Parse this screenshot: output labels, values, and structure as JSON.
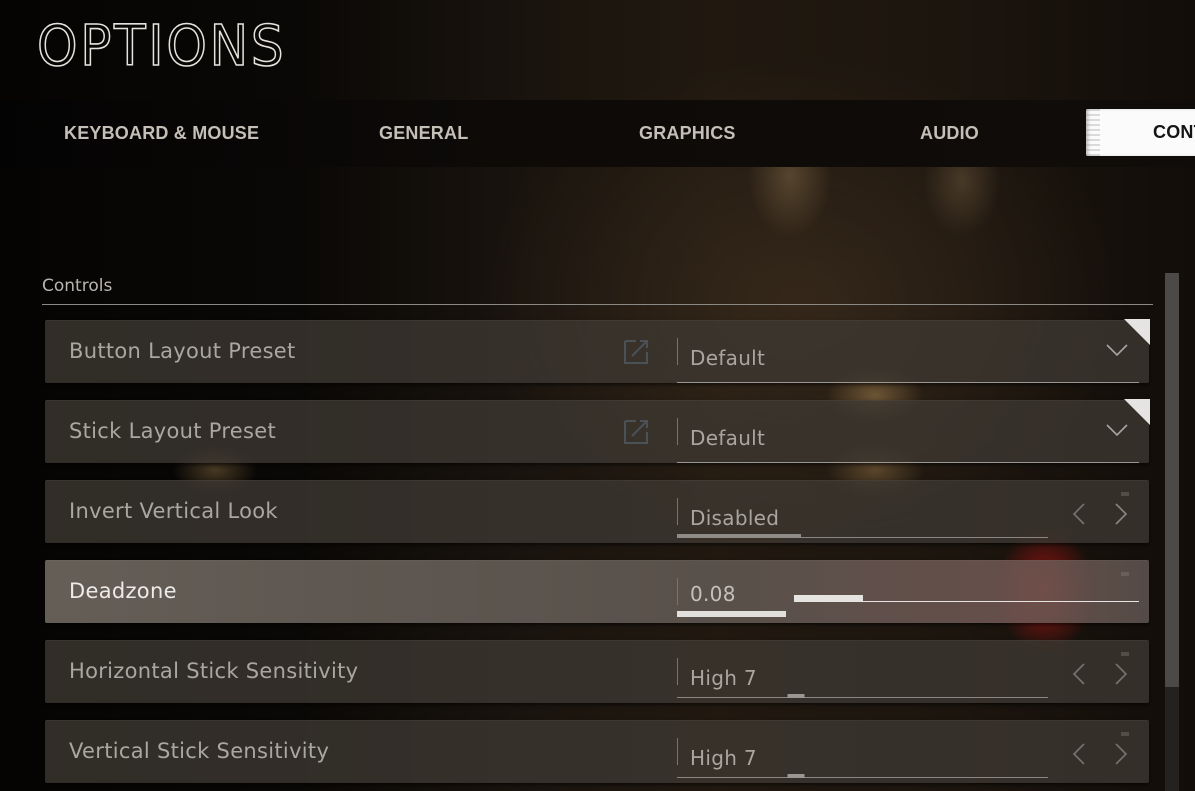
{
  "header": {
    "title": "OPTIONS"
  },
  "tabs": [
    {
      "label": "KEYBOARD & MOUSE",
      "active": false
    },
    {
      "label": "GENERAL",
      "active": false
    },
    {
      "label": "GRAPHICS",
      "active": false
    },
    {
      "label": "AUDIO",
      "active": false
    },
    {
      "label": "CONT",
      "active": true
    }
  ],
  "section": {
    "label": "Controls"
  },
  "settings": [
    {
      "label": "Button Layout Preset",
      "type": "dropdown",
      "value": "Default",
      "icons": [
        "external-link-icon",
        "chevron-down-icon"
      ]
    },
    {
      "label": "Stick Layout Preset",
      "type": "dropdown",
      "value": "Default",
      "icons": [
        "external-link-icon",
        "chevron-down-icon"
      ]
    },
    {
      "label": "Invert Vertical Look",
      "type": "selector",
      "value": "Disabled",
      "option_index": 1,
      "option_count": 3,
      "fill_fraction": 0.333,
      "icons": [
        "chevron-left-icon",
        "chevron-right-icon"
      ]
    },
    {
      "label": "Deadzone",
      "type": "slider",
      "value": "0.08",
      "focused": true,
      "slider_fraction": 0.2
    },
    {
      "label": "Horizontal Stick Sensitivity",
      "type": "selector",
      "value": "High 7",
      "marker_fraction": 0.32,
      "icons": [
        "chevron-left-icon",
        "chevron-right-icon"
      ]
    },
    {
      "label": "Vertical Stick Sensitivity",
      "type": "selector",
      "value": "High 7",
      "marker_fraction": 0.32,
      "icons": [
        "chevron-left-icon",
        "chevron-right-icon"
      ]
    }
  ],
  "scrollbar": {
    "visible_fraction": 0.8,
    "position_fraction": 0.0
  },
  "colors": {
    "active_tab_bg": "#fbfbfb",
    "active_tab_text": "#151515",
    "tab_text": "#c4bfb7",
    "row_bg": "#3e3832",
    "focused_row_bg": "#766e66",
    "slider_fill": "#e6e4e1",
    "corner_triangle": "#e6e4e2"
  }
}
